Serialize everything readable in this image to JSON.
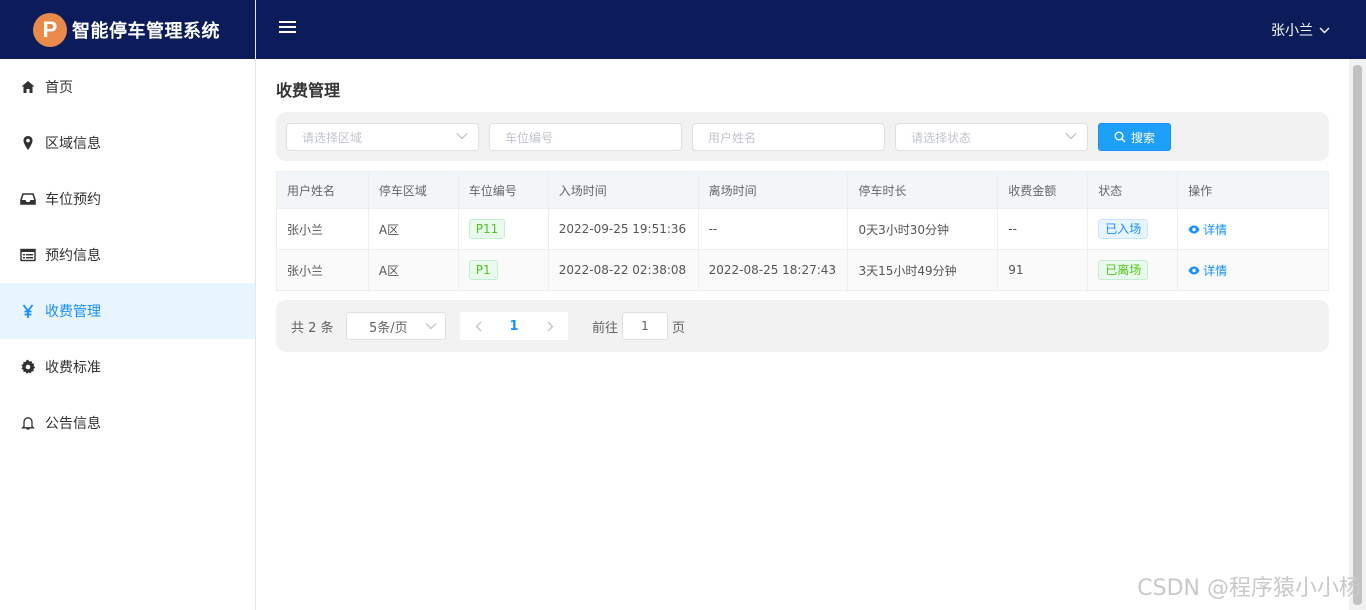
{
  "app": {
    "logo_letter": "P",
    "title": "智能停车管理系统",
    "brand_color": "#0c1c5a",
    "accent": "#1890ff"
  },
  "topbar": {
    "user_name": "张小兰"
  },
  "sidebar": {
    "items": [
      {
        "label": "首页",
        "icon": "home-icon"
      },
      {
        "label": "区域信息",
        "icon": "location-pin-icon"
      },
      {
        "label": "车位预约",
        "icon": "inbox-icon"
      },
      {
        "label": "预约信息",
        "icon": "list-card-icon"
      },
      {
        "label": "收费管理",
        "icon": "yen-icon",
        "active": true
      },
      {
        "label": "收费标准",
        "icon": "gear-icon"
      },
      {
        "label": "公告信息",
        "icon": "bell-icon"
      }
    ]
  },
  "page": {
    "title": "收费管理"
  },
  "filters": {
    "area_placeholder": "请选择区域",
    "space_placeholder": "车位编号",
    "user_placeholder": "用户姓名",
    "status_placeholder": "请选择状态",
    "search_label": "搜索"
  },
  "table": {
    "headers": [
      "用户姓名",
      "停车区域",
      "车位编号",
      "入场时间",
      "离场时间",
      "停车时长",
      "收费金额",
      "状态",
      "操作"
    ],
    "rows": [
      {
        "user": "张小兰",
        "area": "A区",
        "space": "P11",
        "in_time": "2022-09-25 19:51:36",
        "out_time": "--",
        "duration": "0天3小时30分钟",
        "amount": "--",
        "status": "已入场",
        "status_color": "blue",
        "action": "详情"
      },
      {
        "user": "张小兰",
        "area": "A区",
        "space": "P1",
        "in_time": "2022-08-22 02:38:08",
        "out_time": "2022-08-25 18:27:43",
        "duration": "3天15小时49分钟",
        "amount": "91",
        "status": "已离场",
        "status_color": "green",
        "action": "详情"
      }
    ]
  },
  "pagination": {
    "total": "共 2 条",
    "page_size": "5条/页",
    "current_page": "1",
    "goto_label": "前往",
    "goto_value": "1",
    "page_suffix": "页"
  },
  "watermark": "CSDN @程序猿小小杨"
}
